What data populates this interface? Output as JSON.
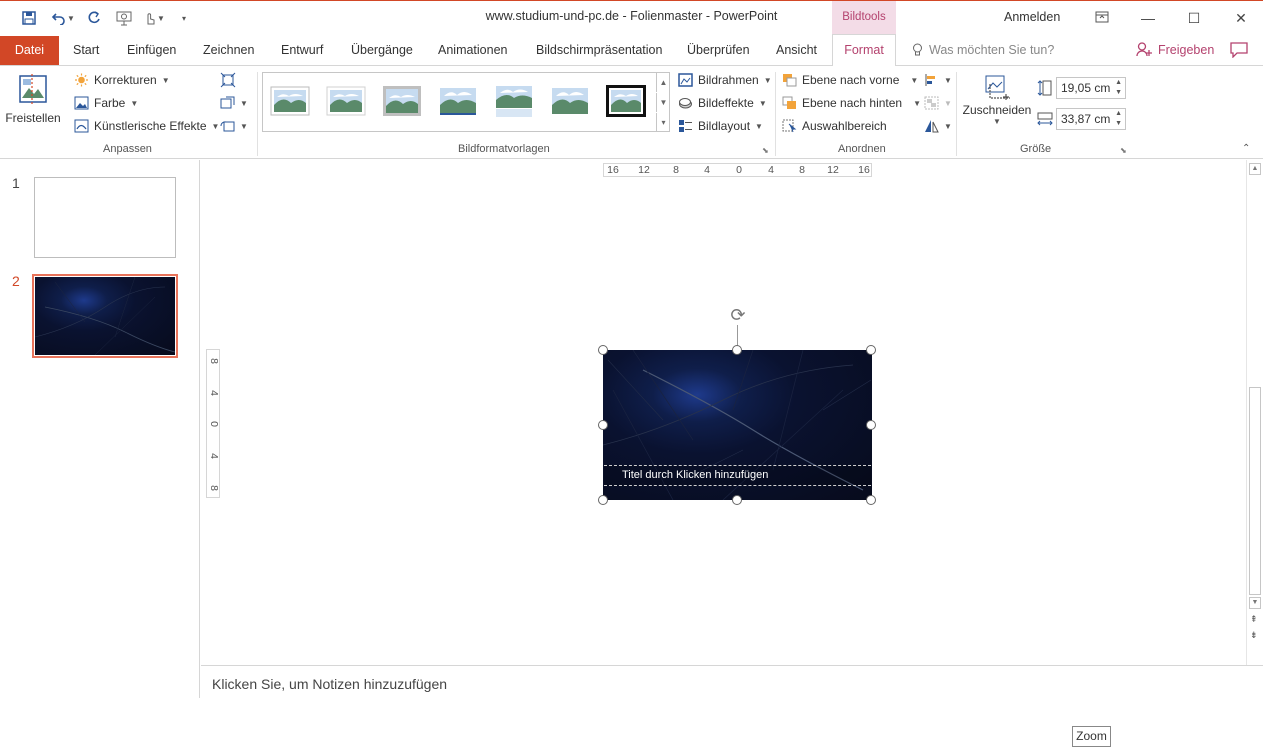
{
  "window": {
    "title": "www.studium-und-pc.de - Folienmaster  -  PowerPoint",
    "context_tab": "Bildtools",
    "signin": "Anmelden"
  },
  "tabs": {
    "file": "Datei",
    "items": [
      "Start",
      "Einfügen",
      "Zeichnen",
      "Entwurf",
      "Übergänge",
      "Animationen",
      "Bildschirmpräsentation",
      "Überprüfen",
      "Ansicht"
    ],
    "active": "Format",
    "tell_me": "Was möchten Sie tun?",
    "share": "Freigeben"
  },
  "ribbon": {
    "adjust": {
      "label": "Anpassen",
      "remove_bg": "Freistellen",
      "corrections": "Korrekturen",
      "color": "Farbe",
      "artistic": "Künstlerische Effekte"
    },
    "styles": {
      "label": "Bildformatvorlagen",
      "border": "Bildrahmen",
      "effects": "Bildeffekte",
      "layout": "Bildlayout"
    },
    "arrange": {
      "label": "Anordnen",
      "bring_forward": "Ebene nach vorne",
      "send_backward": "Ebene nach hinten",
      "selection_pane": "Auswahlbereich"
    },
    "size": {
      "label": "Größe",
      "crop": "Zuschneiden",
      "height": "19,05  cm",
      "width": "33,87  cm"
    }
  },
  "thumbnails": {
    "slide1_num": "1",
    "slide2_num": "2"
  },
  "slide": {
    "title_placeholder": "Titel durch Klicken hinzufügen"
  },
  "hruler": [
    "16",
    "12",
    "8",
    "4",
    "0",
    "4",
    "8",
    "12",
    "16"
  ],
  "vruler": [
    "8",
    "4",
    "0",
    "4",
    "8"
  ],
  "notes": "Klicken Sie, um Notizen hinzuzufügen",
  "zoom_tooltip": "Zoom",
  "colors": {
    "accent": "#d24726",
    "context": "#b4426e",
    "context_bg": "#f3dce7"
  }
}
